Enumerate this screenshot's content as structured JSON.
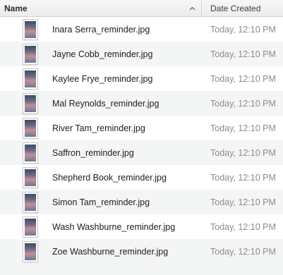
{
  "header": {
    "name_label": "Name",
    "date_label": "Date Created",
    "sort_icon": "chevron-up-icon"
  },
  "files": [
    {
      "name": "Inara Serra_reminder.jpg",
      "date": "Today, 12:10 PM"
    },
    {
      "name": "Jayne Cobb_reminder.jpg",
      "date": "Today, 12:10 PM"
    },
    {
      "name": "Kaylee Frye_reminder.jpg",
      "date": "Today, 12:10 PM"
    },
    {
      "name": "Mal Reynolds_reminder.jpg",
      "date": "Today, 12:10 PM"
    },
    {
      "name": "River Tam_reminder.jpg",
      "date": "Today, 12:10 PM"
    },
    {
      "name": "Saffron_reminder.jpg",
      "date": "Today, 12:10 PM"
    },
    {
      "name": "Shepherd Book_reminder.jpg",
      "date": "Today, 12:10 PM"
    },
    {
      "name": "Simon Tam_reminder.jpg",
      "date": "Today, 12:10 PM"
    },
    {
      "name": "Wash Washburne_reminder.jpg",
      "date": "Today, 12:10 PM"
    },
    {
      "name": "Zoe Washburne_reminder.jpg",
      "date": "Today, 12:10 PM"
    }
  ]
}
